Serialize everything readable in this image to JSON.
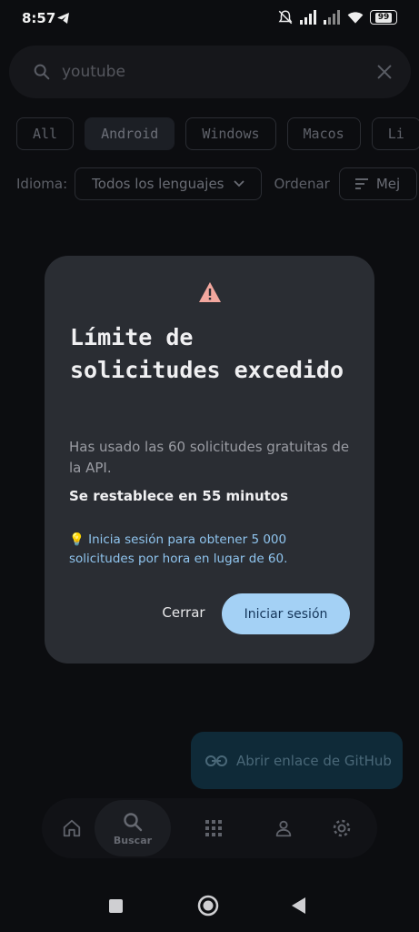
{
  "status_bar": {
    "time": "8:57",
    "battery": "99"
  },
  "search": {
    "value": "youtube"
  },
  "platform_chips": [
    "All",
    "Android",
    "Windows",
    "Macos",
    "Li"
  ],
  "filters": {
    "language_label": "Idioma:",
    "language_value": "Todos los lenguajes",
    "sort_label": "Ordenar",
    "sort_value": "Mej"
  },
  "dialog": {
    "title": "Límite de solicitudes excedido",
    "body": "Has usado las 60 solicitudes gratuitas de la API.",
    "reset_text": "Se restablece en 55 minutos",
    "tip": "💡 Inicia sesión para obtener 5 000 solicitudes por hora en lugar de 60.",
    "close_label": "Cerrar",
    "login_label": "Iniciar sesión"
  },
  "fab": {
    "label": "Abrir enlace de GitHub"
  },
  "bottom_nav": {
    "active_label": "Buscar",
    "items": [
      "home-icon",
      "search-icon",
      "apps-icon",
      "profile-icon",
      "settings-icon"
    ]
  },
  "colors": {
    "accent": "#a4d1f5",
    "dialog_bg": "#2a2d33",
    "warning": "#f2a79e"
  }
}
